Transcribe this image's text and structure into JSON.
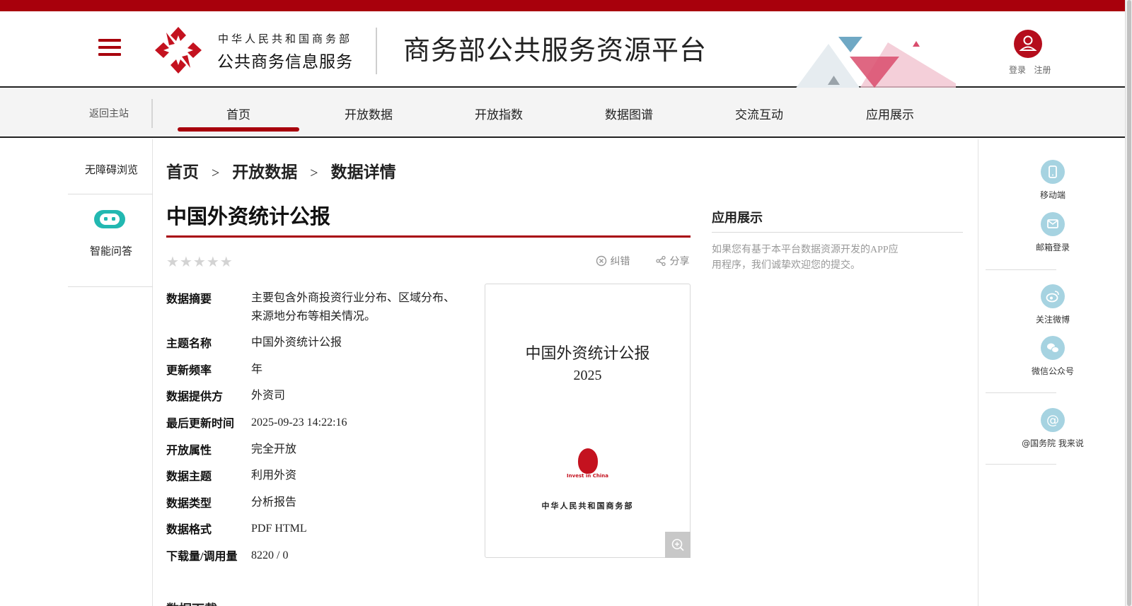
{
  "header": {
    "org_line": "中华人民共和国商务部",
    "org_name": "公共商务信息服务",
    "platform_title": "商务部公共服务资源平台",
    "login": "登录",
    "register": "注册"
  },
  "nav": {
    "back_home": "返回主站",
    "items": [
      "首页",
      "开放数据",
      "开放指数",
      "数据图谱",
      "交流互动",
      "应用展示"
    ],
    "active": "首页"
  },
  "left_panel": {
    "accessibility": "无障碍浏览",
    "assistant": "智能问答"
  },
  "right_panel": {
    "items": [
      "移动端",
      "邮箱登录",
      "关注微博",
      "微信公众号",
      "@国务院 我来说"
    ]
  },
  "breadcrumb": [
    "首页",
    "开放数据",
    "数据详情"
  ],
  "breadcrumb_sep": ">",
  "dataset": {
    "title": "中国外资统计公报",
    "rating": 0,
    "rating_max": 5,
    "actions": {
      "report": "纠错",
      "share": "分享"
    },
    "meta": [
      {
        "key": "数据摘要",
        "value": "主要包含外商投资行业分布、区域分布、来源地分布等相关情况。"
      },
      {
        "key": "主题名称",
        "value": "中国外资统计公报"
      },
      {
        "key": "更新频率",
        "value": "年"
      },
      {
        "key": "数据提供方",
        "value": "外资司"
      },
      {
        "key": "最后更新时间",
        "value": "2025-09-23 14:22:16"
      },
      {
        "key": "开放属性",
        "value": "完全开放"
      },
      {
        "key": "数据主题",
        "value": "利用外资"
      },
      {
        "key": "数据类型",
        "value": "分析报告"
      },
      {
        "key": "数据格式",
        "value": "PDF HTML"
      },
      {
        "key": "下载量/调用量",
        "value": "8220 / 0"
      }
    ],
    "cover": {
      "title": "中国外资统计公报",
      "year": "2025",
      "brand": "Invest in China",
      "ministry": "中华人民共和国商务部"
    }
  },
  "app_showcase": {
    "title": "应用展示",
    "text": "如果您有基于本平台数据资源开发的APP应用程序，我们诚挚欢迎您的提交。"
  },
  "download": {
    "title": "数据下载"
  },
  "colors": {
    "brand_red": "#a8000c",
    "icon_teal": "#22b8b1",
    "side_icon_blue": "#a6d3e1"
  }
}
